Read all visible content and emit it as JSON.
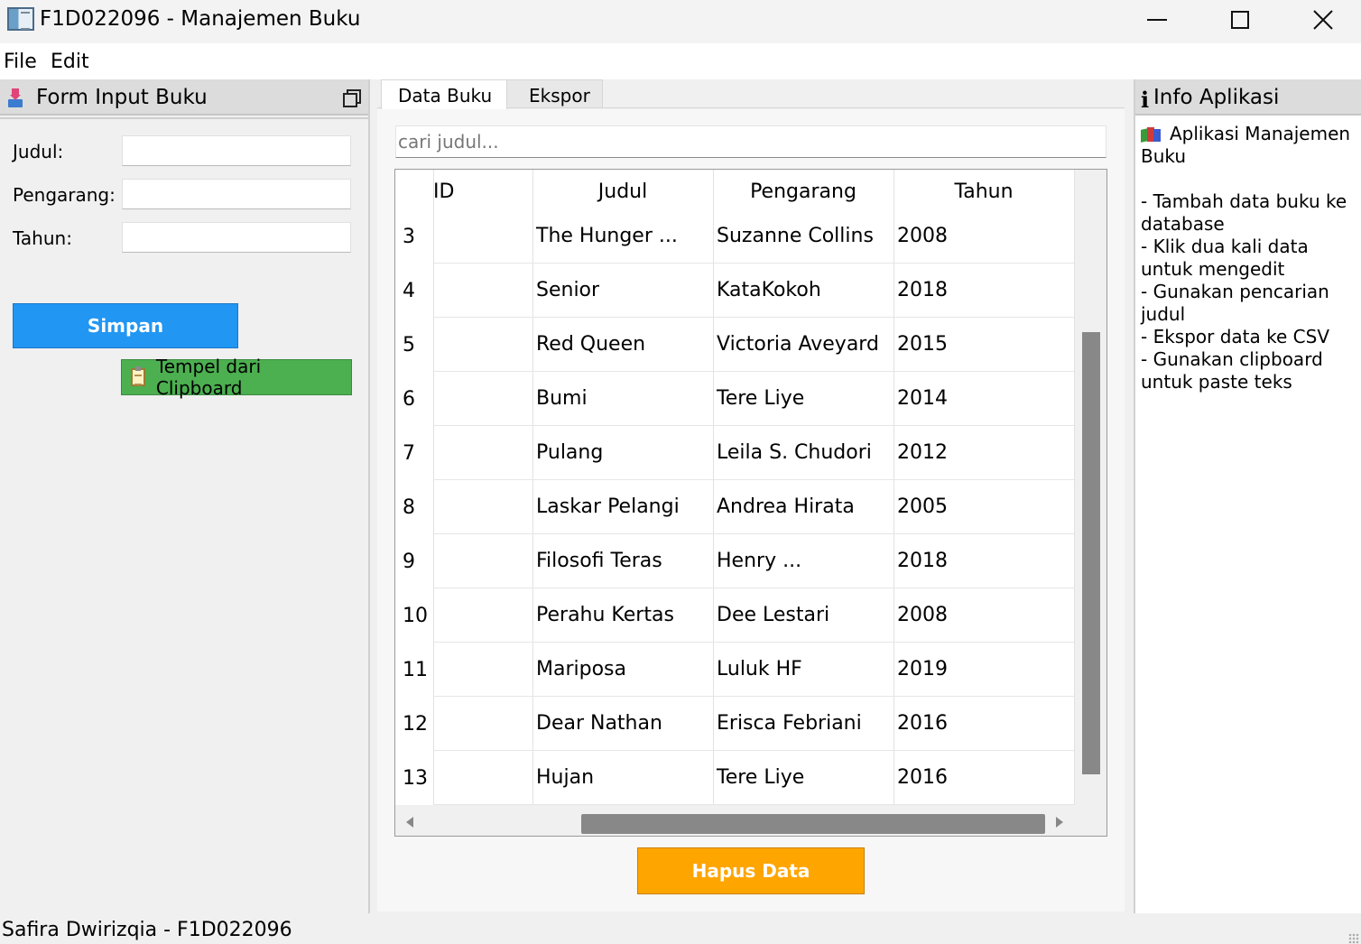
{
  "window": {
    "title": "F1D022096 - Manajemen Buku"
  },
  "menu": {
    "file": "File",
    "edit": "Edit"
  },
  "form_dock": {
    "title": "Form Input Buku",
    "judul_label": "Judul:",
    "pengarang_label": "Pengarang:",
    "tahun_label": "Tahun:",
    "judul_value": "",
    "pengarang_value": "",
    "tahun_value": "",
    "save_label": "Simpan",
    "paste_label": "Tempel dari Clipboard",
    "save_color": "#2196f3",
    "paste_color": "#4caf50"
  },
  "tabs": {
    "data": "Data Buku",
    "export": "Ekspor"
  },
  "search": {
    "placeholder": "cari judul..."
  },
  "table": {
    "headers": [
      "ID",
      "Judul",
      "Pengarang",
      "Tahun"
    ],
    "rows": [
      {
        "num": "3",
        "id": "",
        "judul": "The Hunger ...",
        "pengarang": "Suzanne Collins",
        "tahun": "2008"
      },
      {
        "num": "4",
        "id": "",
        "judul": "Senior",
        "pengarang": "KataKokoh",
        "tahun": "2018"
      },
      {
        "num": "5",
        "id": "",
        "judul": "Red Queen",
        "pengarang": "Victoria Aveyard",
        "tahun": "2015"
      },
      {
        "num": "6",
        "id": "",
        "judul": "Bumi",
        "pengarang": "Tere Liye",
        "tahun": "2014"
      },
      {
        "num": "7",
        "id": "",
        "judul": "Pulang",
        "pengarang": "Leila S. Chudori",
        "tahun": "2012"
      },
      {
        "num": "8",
        "id": "",
        "judul": "Laskar Pelangi",
        "pengarang": "Andrea Hirata",
        "tahun": "2005"
      },
      {
        "num": "9",
        "id": "",
        "judul": "Filosofi Teras",
        "pengarang": "Henry ...",
        "tahun": "2018"
      },
      {
        "num": "10",
        "id": "",
        "judul": "Perahu Kertas",
        "pengarang": "Dee Lestari",
        "tahun": "2008"
      },
      {
        "num": "11",
        "id": "",
        "judul": "Mariposa",
        "pengarang": "Luluk HF",
        "tahun": "2019"
      },
      {
        "num": "12",
        "id": "",
        "judul": "Dear Nathan",
        "pengarang": "Erisca Febriani",
        "tahun": "2016"
      },
      {
        "num": "13",
        "id": "",
        "judul": "Hujan",
        "pengarang": "Tere Liye",
        "tahun": "2016"
      }
    ]
  },
  "delete_button": {
    "label": "Hapus Data",
    "color": "#ffa500"
  },
  "info_dock": {
    "title": "Info Aplikasi",
    "app_name": "Aplikasi Manajemen Buku",
    "lines": [
      "- Tambah data buku ke database",
      "- Klik dua kali data untuk mengedit",
      "- Gunakan pencarian judul",
      "- Ekspor data ke CSV",
      "- Gunakan clipboard untuk paste teks"
    ]
  },
  "status": {
    "text": "Safira Dwirizqia - F1D022096"
  },
  "icons": [
    "app-icon",
    "minimize-icon",
    "maximize-icon",
    "close-icon",
    "inbox-icon",
    "float-icon",
    "clipboard-icon",
    "info-icon",
    "books-icon",
    "scroll-left-icon",
    "scroll-right-icon"
  ]
}
